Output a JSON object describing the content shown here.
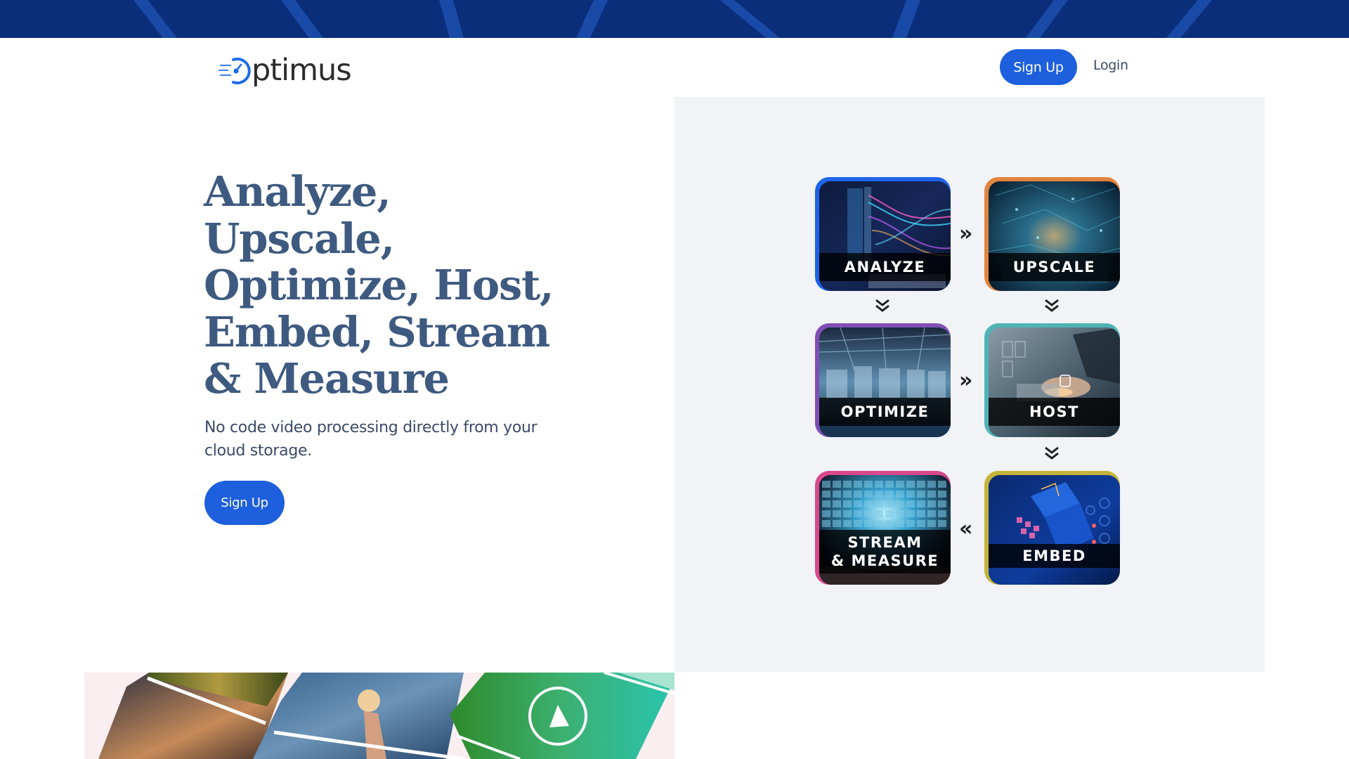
{
  "colors": {
    "banner": "#0a2e7a",
    "banner_stripe": "#1a4aa8",
    "accent": "#1d5fdc",
    "heading": "#3e5a80",
    "body_text": "#3b4a66",
    "panel_bg": "#f1f3f7",
    "collage_bg": "#fbeef0"
  },
  "header": {
    "logo_text": "ptimus",
    "logo_icon": "speedometer-o-icon",
    "signup_label": "Sign Up",
    "login_label": "Login"
  },
  "hero": {
    "title_lines": [
      "Analyze,",
      "Upscale,",
      "Optimize, Host,",
      "Embed, Stream",
      "& Measure"
    ],
    "subtitle": "No code video processing directly from your cloud storage.",
    "signup_label": "Sign Up"
  },
  "workflow": {
    "tiles": [
      {
        "id": "analyze",
        "lines": [
          "ANALYZE"
        ],
        "border_color": "#1e63e9",
        "image": "data-visualization-laptop"
      },
      {
        "id": "upscale",
        "lines": [
          "UPSCALE"
        ],
        "border_color": "#e0843e",
        "image": "futuristic-data-city"
      },
      {
        "id": "optimize",
        "lines": [
          "OPTIMIZE"
        ],
        "border_color": "#7f4fb6",
        "image": "digital-factory"
      },
      {
        "id": "host",
        "lines": [
          "HOST"
        ],
        "border_color": "#4fb3b5",
        "image": "laptop-security-lock"
      },
      {
        "id": "embed",
        "lines": [
          "EMBED"
        ],
        "border_color": "#c4b43a",
        "image": "isometric-code-devices"
      },
      {
        "id": "stream",
        "lines": [
          "STREAM",
          "& MEASURE"
        ],
        "border_color": "#d9488b",
        "image": "video-wall-screens"
      }
    ],
    "arrows": {
      "right": "»",
      "left": "«",
      "down_icon": "double-chevron-down-icon"
    }
  },
  "collage": {
    "images": [
      "city-sunset-bokeh",
      "hand-lightbulb-gears",
      "green-leaf-play"
    ],
    "play_icon": "play-circle-icon"
  }
}
